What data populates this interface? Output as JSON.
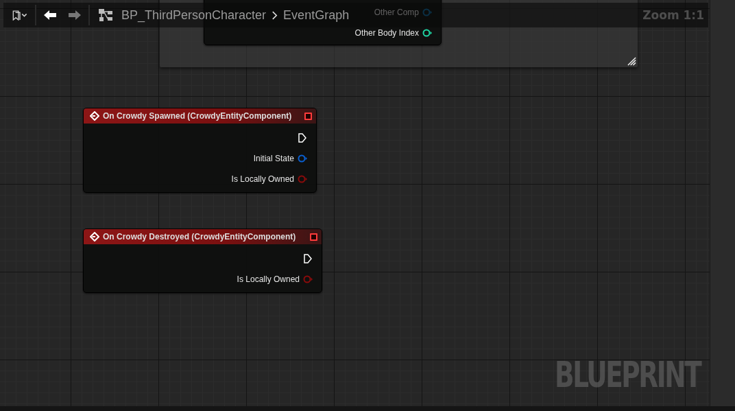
{
  "toolbar": {
    "breadcrumb": [
      "BP_ThirdPersonCharacter",
      "EventGraph"
    ],
    "zoom": "Zoom 1:1"
  },
  "nodes": [
    {
      "kind": "partial",
      "pins": [
        {
          "label": "Other Comp",
          "kind": "object"
        },
        {
          "label": "Other Body Index",
          "kind": "int"
        }
      ]
    },
    {
      "kind": "event",
      "title": "On Crowdy Spawned (CrowdyEntityComponent)",
      "pins": [
        {
          "kind": "exec"
        },
        {
          "label": "Initial State",
          "kind": "struct"
        },
        {
          "label": "Is Locally Owned",
          "kind": "bool"
        }
      ]
    },
    {
      "kind": "event",
      "title": "On Crowdy Destroyed (CrowdyEntityComponent)",
      "pins": [
        {
          "kind": "exec"
        },
        {
          "label": "Is Locally Owned",
          "kind": "bool"
        }
      ]
    }
  ],
  "watermark": "BLUEPRINT"
}
